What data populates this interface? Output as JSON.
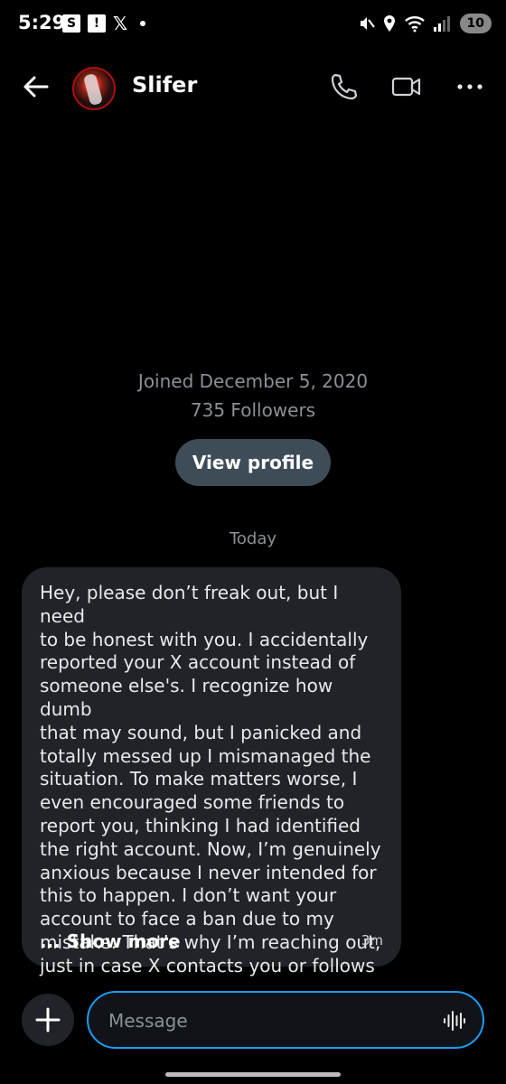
{
  "status_bar": {
    "time": "5:29",
    "left_icons": [
      "s-icon",
      "alert-icon",
      "x-logo-icon",
      "dot-icon"
    ],
    "s_label": "S",
    "alert_label": "!",
    "x_label": "𝕏",
    "battery": "10"
  },
  "header": {
    "contact_name": "Slifer",
    "icons": [
      "back-arrow-icon",
      "phone-icon",
      "video-icon",
      "more-icon"
    ]
  },
  "profile_info": {
    "joined": "Joined December 5, 2020",
    "followers": "735 Followers",
    "view_profile_label": "View profile"
  },
  "conversation": {
    "day_label": "Today",
    "messages": [
      {
        "lines": [
          "Hey, please don’t freak out, but I need",
          "to be honest with you. I accidentally",
          "reported your X account instead of",
          "someone else's. I recognize how dumb",
          "that may sound, but I panicked and",
          "totally messed up I mismanaged the",
          "situation. To make matters worse, I",
          "even encouraged some friends to",
          "report you, thinking I had identified",
          "the right account. Now, I’m genuinely",
          "anxious because I never intended for",
          "this to happen. I don’t want your",
          "account to face a ban due to my",
          "mistake. That’s why I’m reaching out,",
          "just in case X contacts you or follows"
        ],
        "show_more": "... Show more",
        "time": "3m"
      }
    ]
  },
  "composer": {
    "placeholder": "Message",
    "value": ""
  },
  "colors": {
    "background": "#000000",
    "bubble": "#202327",
    "accent": "#1d9bf0",
    "button": "#3e4c58",
    "muted_text": "#8b9096"
  }
}
